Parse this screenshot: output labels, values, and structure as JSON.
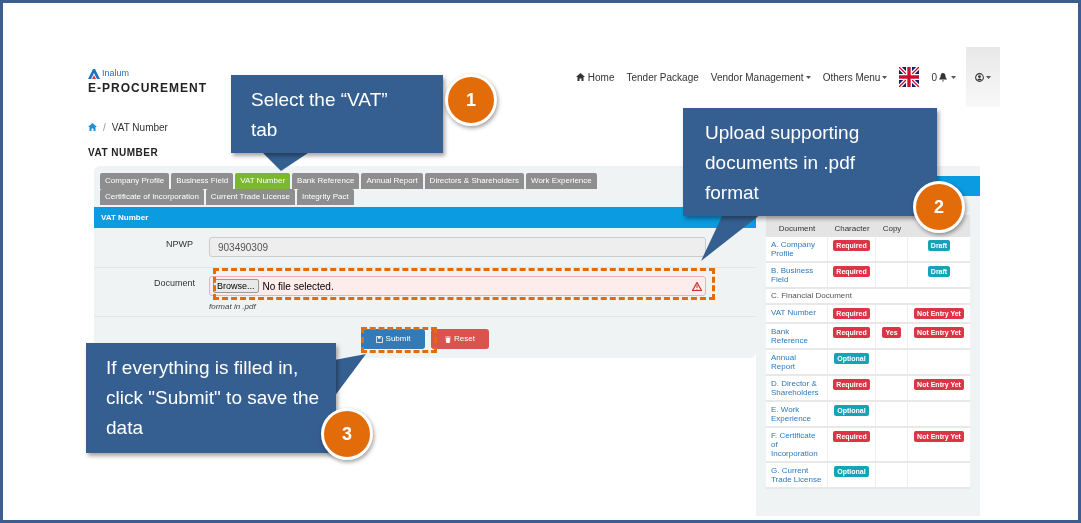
{
  "header": {
    "logo_brand": "Inalum",
    "logo_title": "E-PROCUREMENT",
    "nav": [
      {
        "label": "Home",
        "kind": "home"
      },
      {
        "label": "Tender Package",
        "kind": "link"
      },
      {
        "label": "Vendor Management",
        "kind": "dropdown"
      },
      {
        "label": "Others Menu",
        "kind": "dropdown"
      }
    ],
    "notifications": "0"
  },
  "breadcrumb": {
    "separator": "/",
    "current": "VAT Number"
  },
  "page_title": "VAT NUMBER",
  "tabs": [
    {
      "label": "Company Profile",
      "selected": false
    },
    {
      "label": "Business Field",
      "selected": false
    },
    {
      "label": "VAT Number",
      "selected": true
    },
    {
      "label": "Bank Reference",
      "selected": false
    },
    {
      "label": "Annual Report",
      "selected": false
    },
    {
      "label": "Directors & Shareholders",
      "selected": false
    },
    {
      "label": "Work Experience",
      "selected": false
    },
    {
      "label": "Certificate of Incorporation",
      "selected": false
    },
    {
      "label": "Current Trade License",
      "selected": false
    },
    {
      "label": "Integrity Pact",
      "selected": false
    }
  ],
  "form": {
    "section_title": "VAT Number",
    "fields": [
      {
        "label": "NPWP",
        "kind": "text",
        "value": "903490309"
      },
      {
        "label": "Document",
        "kind": "file",
        "button": "Browse...",
        "value": "No file selected.",
        "help": "format in .pdf",
        "error": true
      }
    ],
    "buttons": [
      {
        "label": "Submit",
        "kind": "primary"
      },
      {
        "label": "Reset",
        "kind": "danger"
      }
    ]
  },
  "checklist": {
    "columns": [
      "Document",
      "Character",
      "Copy"
    ],
    "rows": [
      {
        "kind": "item",
        "document": "A. Company Profile",
        "character": {
          "text": "Required",
          "color": "#dc3545"
        },
        "status": {
          "text": "Draft",
          "color": "#17a2b8"
        }
      },
      {
        "kind": "item",
        "document": "B. Business Field",
        "character": {
          "text": "Required",
          "color": "#dc3545"
        },
        "status": {
          "text": "Draft",
          "color": "#17a2b8"
        }
      },
      {
        "kind": "section",
        "document": "C. Financial Document"
      },
      {
        "kind": "item",
        "document": "VAT Number",
        "character": {
          "text": "Required",
          "color": "#dc3545"
        },
        "status": {
          "text": "Not Entry Yet",
          "color": "#dc3545"
        }
      },
      {
        "kind": "item",
        "document": "Bank Reference",
        "character": {
          "text": "Required",
          "color": "#dc3545"
        },
        "copy": {
          "text": "Yes",
          "color": "#dc3545"
        },
        "status": {
          "text": "Not Entry Yet",
          "color": "#dc3545"
        }
      },
      {
        "kind": "item",
        "document": "Annual Report",
        "character": {
          "text": "Optional",
          "color": "#17a2b8"
        }
      },
      {
        "kind": "item",
        "document": "D. Director & Shareholders",
        "character": {
          "text": "Required",
          "color": "#dc3545"
        },
        "status": {
          "text": "Not Entry Yet",
          "color": "#dc3545"
        }
      },
      {
        "kind": "item",
        "document": "E. Work Experience",
        "character": {
          "text": "Optional",
          "color": "#17a2b8"
        }
      },
      {
        "kind": "item",
        "document": "F. Certificate of Incorporation",
        "character": {
          "text": "Required",
          "color": "#dc3545"
        },
        "status": {
          "text": "Not Entry Yet",
          "color": "#dc3545"
        }
      },
      {
        "kind": "item",
        "document": "G. Current Trade License",
        "character": {
          "text": "Optional",
          "color": "#17a2b8"
        }
      }
    ]
  },
  "callouts": [
    {
      "number": "1",
      "text": "Select the “VAT” tab"
    },
    {
      "number": "2",
      "text": "Upload supporting documents in .pdf format"
    },
    {
      "number": "3",
      "text": "If everything is filled in, click \"Submit\" to save the data"
    }
  ]
}
